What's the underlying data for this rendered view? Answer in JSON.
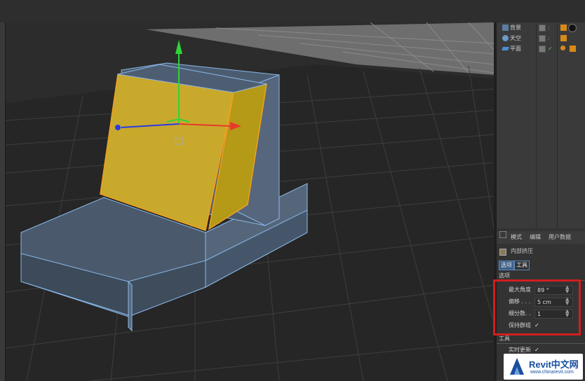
{
  "object_manager": {
    "items": [
      {
        "label": "背景",
        "icon": "background-object-icon"
      },
      {
        "label": "天空",
        "icon": "sky-object-icon"
      },
      {
        "label": "平面",
        "icon": "plane-object-icon"
      }
    ]
  },
  "attributes": {
    "tabs": [
      "模式",
      "编辑",
      "用户数据"
    ],
    "tool_name": "内部挤压",
    "subtabs": [
      "选项",
      "工具"
    ],
    "options_header": "选项",
    "fields": [
      {
        "label": "最大角度",
        "value": "89 °"
      },
      {
        "label": "偏移 . . .",
        "value": "5 cm"
      },
      {
        "label": "细分数. .",
        "value": "1"
      }
    ],
    "preserve_groups": {
      "label": "保持群组",
      "checked": "✓"
    },
    "tool_header": "工具",
    "realtime_update": {
      "label": "实时更新",
      "checked": "✓"
    }
  },
  "watermark": {
    "title": "Revit中文网",
    "url": "www.chinarevit.com"
  },
  "colors": {
    "selection_fill": "#c8a92c",
    "highlight_box": "#d21e1e",
    "axis_y": "#2fd43a",
    "axis_x": "#e63a2a",
    "axis_z": "#2a3ae6"
  }
}
